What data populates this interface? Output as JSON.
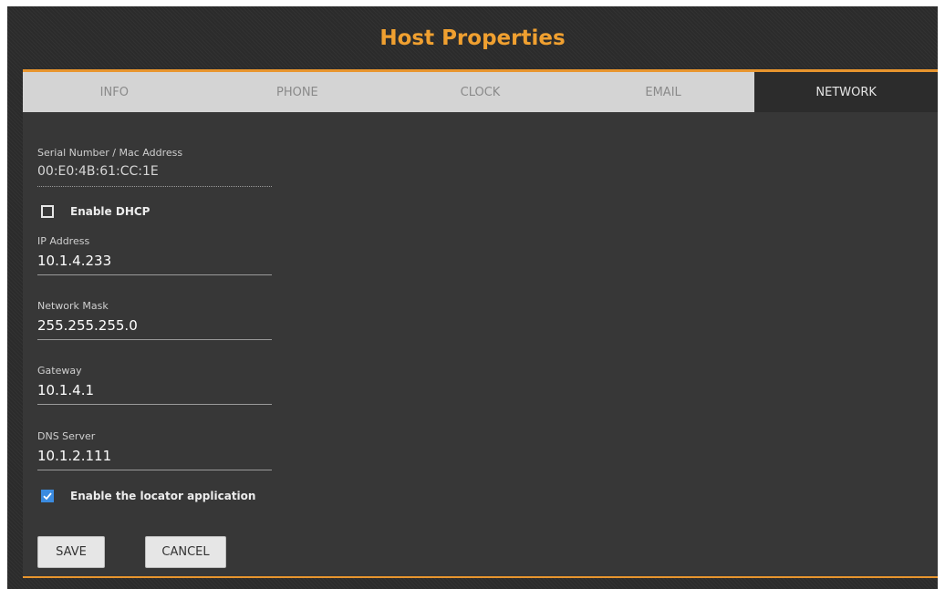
{
  "dialog": {
    "title": "Host Properties"
  },
  "tabs": [
    {
      "label": "INFO",
      "active": false
    },
    {
      "label": "PHONE",
      "active": false
    },
    {
      "label": "CLOCK",
      "active": false
    },
    {
      "label": "EMAIL",
      "active": false
    },
    {
      "label": "NETWORK",
      "active": true
    }
  ],
  "network": {
    "serial": {
      "label": "Serial Number / Mac Address",
      "value": "00:E0:4B:61:CC:1E"
    },
    "dhcp": {
      "label": "Enable DHCP",
      "checked": false
    },
    "ip": {
      "label": "IP Address",
      "value": "10.1.4.233"
    },
    "mask": {
      "label": "Network Mask",
      "value": "255.255.255.0"
    },
    "gateway": {
      "label": "Gateway",
      "value": "10.1.4.1"
    },
    "dns": {
      "label": "DNS Server",
      "value": "10.1.2.111"
    },
    "locator": {
      "label": "Enable the locator application",
      "checked": true
    }
  },
  "buttons": {
    "save": "SAVE",
    "cancel": "CANCEL"
  },
  "colors": {
    "accent": "#e8952e",
    "title": "#f0a030",
    "checkbox": "#3b8be0",
    "panel": "#373737"
  },
  "icons": {
    "checked": "checkmark-icon"
  }
}
